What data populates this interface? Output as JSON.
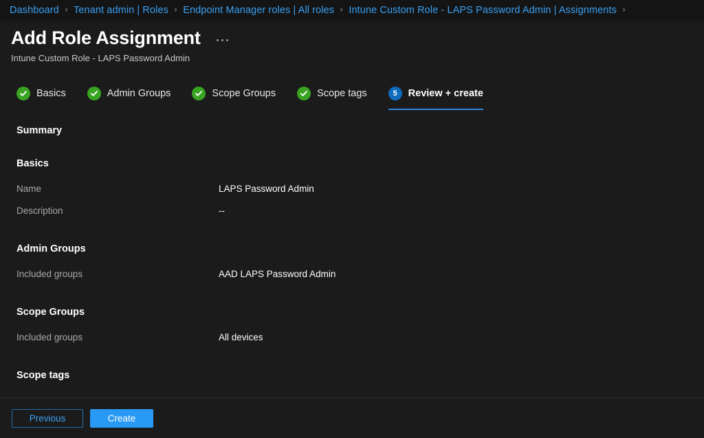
{
  "breadcrumb": {
    "items": [
      {
        "label": "Dashboard"
      },
      {
        "label": "Tenant admin | Roles"
      },
      {
        "label": "Endpoint Manager roles | All roles"
      },
      {
        "label": "Intune Custom Role - LAPS Password Admin | Assignments"
      }
    ],
    "separator": "›",
    "trailing_separator": "›"
  },
  "header": {
    "title": "Add Role Assignment",
    "subtitle": "Intune Custom Role - LAPS Password Admin",
    "more_menu": "…"
  },
  "wizard": {
    "tabs": [
      {
        "label": "Basics",
        "state": "done",
        "badge": "check-icon"
      },
      {
        "label": "Admin Groups",
        "state": "done",
        "badge": "check-icon"
      },
      {
        "label": "Scope Groups",
        "state": "done",
        "badge": "check-icon"
      },
      {
        "label": "Scope tags",
        "state": "done",
        "badge": "check-icon"
      },
      {
        "label": "Review + create",
        "state": "current",
        "badge": "5"
      }
    ]
  },
  "main": {
    "summary_heading": "Summary",
    "groups": [
      {
        "title": "Basics",
        "rows": [
          {
            "label": "Name",
            "value": "LAPS Password Admin"
          },
          {
            "label": "Description",
            "value": "--"
          }
        ]
      },
      {
        "title": "Admin Groups",
        "rows": [
          {
            "label": "Included groups",
            "value": "AAD LAPS Password Admin"
          }
        ]
      },
      {
        "title": "Scope Groups",
        "rows": [
          {
            "label": "Included groups",
            "value": "All devices"
          }
        ]
      },
      {
        "title": "Scope tags",
        "rows": []
      }
    ]
  },
  "footer": {
    "previous_label": "Previous",
    "create_label": "Create"
  },
  "colors": {
    "background": "#1b1b1b",
    "breadcrumb_background": "#141414",
    "link": "#3aa0f3",
    "accent": "#2899f5",
    "success": "#39a322",
    "current_badge": "#0f6cbd",
    "label_text": "#a9a9a9",
    "divider": "#323232"
  }
}
